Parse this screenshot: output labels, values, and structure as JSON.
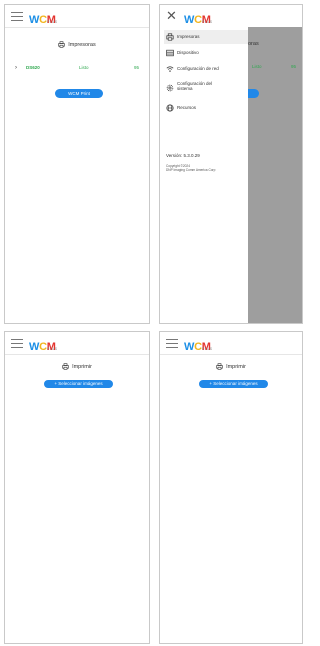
{
  "brand": {
    "w": "W",
    "c": "C",
    "m": "M",
    "plus": "PLUS"
  },
  "screen1": {
    "title": "Impresoras",
    "printer": {
      "name": "DS620",
      "status": "Listo",
      "percent": "95"
    },
    "button": "WCM Print"
  },
  "screen2": {
    "drawer": [
      {
        "label": "Impresoras",
        "icon": "printer-icon"
      },
      {
        "label": "Dispositivo",
        "icon": "device-icon"
      },
      {
        "label": "Configuración de red",
        "icon": "wifi-icon"
      },
      {
        "label": "Configuración del sistema",
        "icon": "settings-icon"
      },
      {
        "label": "Recursos",
        "icon": "globe-icon"
      }
    ],
    "version": "Versión: 5.3.0.29",
    "copyright_line1": "Copyright ©2024",
    "copyright_line2": "DNP Imaging Comm America Corp",
    "behind_title": "oras",
    "behind_status": "Listo",
    "behind_percent": "95"
  },
  "screen3": {
    "title": "Imprimir",
    "button": "+ Seleccionar imágenes"
  },
  "screen4": {
    "title": "Imprimir",
    "button": "+ Seleccionar imágenes"
  },
  "colors": {
    "accent": "#2188e8",
    "ok": "#2fa84f",
    "overlay": "#9e9e9e"
  }
}
